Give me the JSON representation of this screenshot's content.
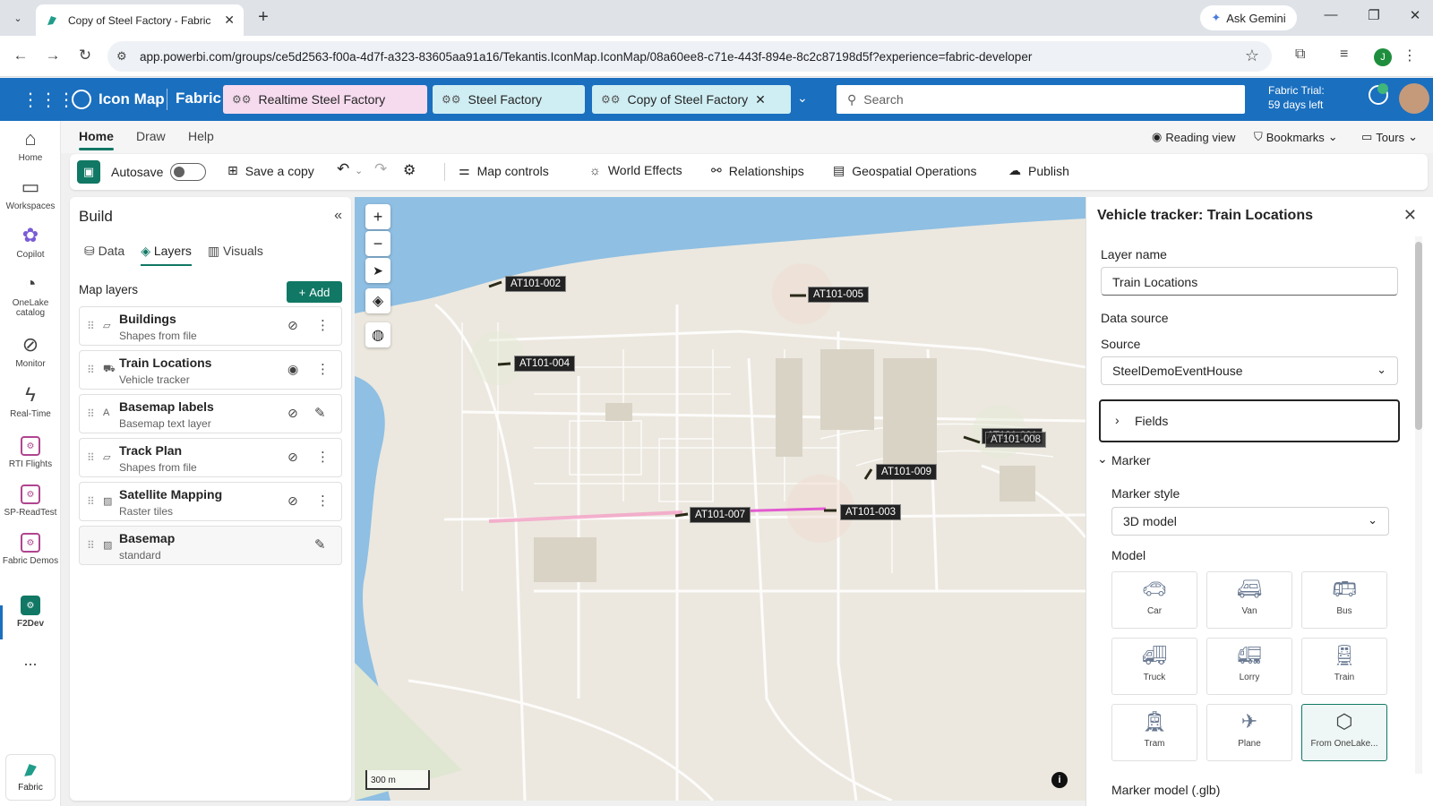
{
  "browser": {
    "tab_title": "Copy of Steel Factory - Fabric",
    "tab_close": "✕",
    "new_tab": "+",
    "gemini": "Ask Gemini",
    "url": "app.powerbi.com/groups/ce5d2563-f00a-4d7f-a323-83605aa91a16/Tekantis.IconMap.IconMap/08a60ee8-c71e-443f-894e-8c2c87198d5f?experience=fabric-developer",
    "profile_initial": "J"
  },
  "header": {
    "app_name": "Icon Map",
    "product": "Fabric",
    "tabs": [
      {
        "label": "Realtime Steel Factory"
      },
      {
        "label": "Steel Factory"
      },
      {
        "label": "Copy of Steel Factory"
      }
    ],
    "search_placeholder": "Search",
    "trial_line1": "Fabric Trial:",
    "trial_line2": "59 days left"
  },
  "rail": {
    "items": [
      {
        "label": "Home"
      },
      {
        "label": "Workspaces"
      },
      {
        "label": "Copilot"
      },
      {
        "label": "OneLake catalog"
      },
      {
        "label": "Monitor"
      },
      {
        "label": "Real-Time"
      },
      {
        "label": "RTI Flights"
      },
      {
        "label": "SP-ReadTest"
      },
      {
        "label": "Fabric Demos"
      },
      {
        "label": "F2Dev"
      }
    ],
    "more": "...",
    "bottom": "Fabric"
  },
  "ribbon": {
    "tabs": [
      "Home",
      "Draw",
      "Help"
    ],
    "reading_view": "Reading view",
    "bookmarks": "Bookmarks",
    "tours": "Tours"
  },
  "toolbar": {
    "autosave": "Autosave",
    "save_copy": "Save a copy",
    "map_controls": "Map controls",
    "world_effects": "World Effects",
    "relationships": "Relationships",
    "geospatial": "Geospatial Operations",
    "publish": "Publish"
  },
  "build": {
    "title": "Build",
    "tabs": [
      "Data",
      "Layers",
      "Visuals"
    ],
    "map_layers": "Map layers",
    "add": "Add",
    "layers": [
      {
        "name": "Buildings",
        "sub": "Shapes from file"
      },
      {
        "name": "Train Locations",
        "sub": "Vehicle tracker"
      },
      {
        "name": "Basemap labels",
        "sub": "Basemap text layer"
      },
      {
        "name": "Track Plan",
        "sub": "Shapes from file"
      },
      {
        "name": "Satellite Mapping",
        "sub": "Raster tiles"
      },
      {
        "name": "Basemap",
        "sub": "standard"
      }
    ]
  },
  "map": {
    "labels": [
      "AT101-002",
      "AT101-005",
      "AT101-004",
      "AT101-001",
      "AT101-008",
      "AT101-009",
      "AT101-007",
      "AT101-003"
    ],
    "scale": "300 m",
    "info": "i"
  },
  "panel": {
    "title": "Vehicle tracker: Train Locations",
    "layer_name_label": "Layer name",
    "layer_name_value": "Train Locations",
    "data_source": "Data source",
    "source_label": "Source",
    "source_value": "SteelDemoEventHouse",
    "fields": "Fields",
    "marker": "Marker",
    "marker_style_label": "Marker style",
    "marker_style_value": "3D model",
    "model_label": "Model",
    "models": [
      "Car",
      "Van",
      "Bus",
      "Truck",
      "Lorry",
      "Train",
      "Tram",
      "Plane",
      "From OneLake..."
    ],
    "marker_model": "Marker model (.glb)"
  },
  "colors": {
    "fabric_blue": "#1a6fbf",
    "accent_green": "#117865",
    "water": "#8fbfe3",
    "tab1_bg": "#f6dbef",
    "tab2_bg": "#cfeef3",
    "tab3_bg": "#cfeef3"
  }
}
